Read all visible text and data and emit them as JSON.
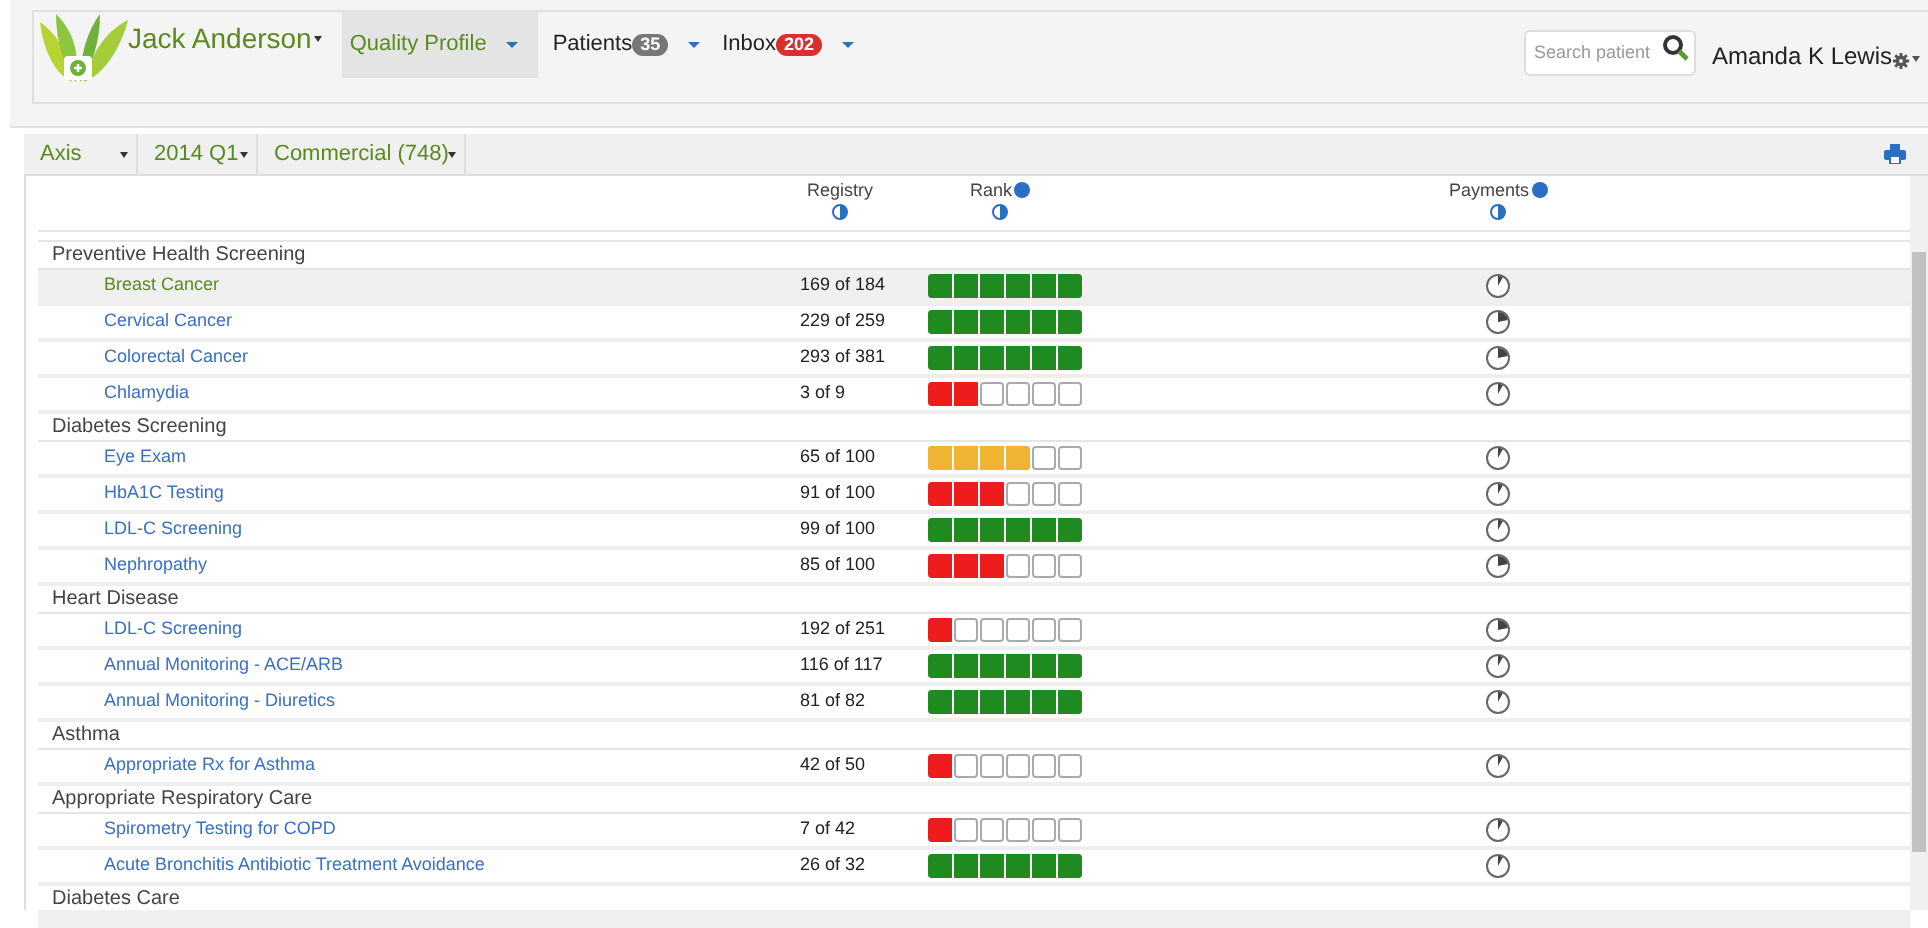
{
  "header": {
    "practice": "Jack Anderson",
    "nav": [
      {
        "label": "Quality Profile",
        "selected": true
      },
      {
        "label": "Patients",
        "badge": "35",
        "color": "#777777",
        "selected": false
      },
      {
        "label": "Inbox",
        "badge": "202",
        "color": "#d9302c",
        "selected": false
      }
    ],
    "search": {
      "placeholder": "Search patient"
    },
    "user": "Amanda K Lewis"
  },
  "filters": [
    "Axis",
    "2014 Q1",
    "Commercial (748)"
  ],
  "table": {
    "columns": [
      "Registry",
      "Rank",
      "Payments"
    ],
    "groups": [
      {
        "name": "Preventive Health Screening",
        "measures": [
          {
            "name": "Breast Cancer",
            "registry": "169 of 184",
            "level": 1,
            "color": "#1f8a1f",
            "payment": {
              "kind": "small"
            },
            "selected": true
          },
          {
            "name": "Cervical Cancer",
            "registry": "229 of 259",
            "level": 1,
            "color": "#1f8a1f",
            "payment": {
              "kind": "large"
            },
            "selected": false
          },
          {
            "name": "Colorectal Cancer",
            "registry": "293 of 381",
            "level": 1,
            "color": "#1f8a1f",
            "payment": {
              "kind": "large"
            },
            "selected": false
          },
          {
            "name": "Chlamydia",
            "registry": "3 of 9",
            "level": 0.333,
            "color": "#ee1c1c",
            "payment": {
              "kind": "small"
            },
            "selected": false
          }
        ]
      },
      {
        "name": "Diabetes Screening",
        "measures": [
          {
            "name": "Eye Exam",
            "registry": "65 of 100",
            "level": 0.667,
            "color": "#f0b332",
            "payment": {
              "kind": "small"
            },
            "selected": false
          },
          {
            "name": "HbA1C Testing",
            "registry": "91 of 100",
            "level": 0.5,
            "color": "#ee1c1c",
            "payment": {
              "kind": "small"
            },
            "selected": false
          },
          {
            "name": "LDL-C Screening",
            "registry": "99 of 100",
            "level": 1,
            "color": "#1f8a1f",
            "payment": {
              "kind": "small"
            },
            "selected": false
          },
          {
            "name": "Nephropathy",
            "registry": "85 of 100",
            "level": 0.5,
            "color": "#ee1c1c",
            "payment": {
              "kind": "large"
            },
            "selected": false
          }
        ]
      },
      {
        "name": "Heart Disease",
        "measures": [
          {
            "name": "LDL-C Screening",
            "registry": "192 of 251",
            "level": 0.167,
            "color": "#ee1c1c",
            "payment": {
              "kind": "large"
            },
            "selected": false
          },
          {
            "name": "Annual Monitoring - ACE/ARB",
            "registry": "116 of 117",
            "level": 1,
            "color": "#1f8a1f",
            "payment": {
              "kind": "small"
            },
            "selected": false
          },
          {
            "name": "Annual Monitoring - Diuretics",
            "registry": "81 of 82",
            "level": 1,
            "color": "#1f8a1f",
            "payment": {
              "kind": "small"
            },
            "selected": false
          }
        ]
      },
      {
        "name": "Asthma",
        "measures": [
          {
            "name": "Appropriate Rx for Asthma",
            "registry": "42 of 50",
            "level": 0.167,
            "color": "#ee1c1c",
            "payment": {
              "kind": "small"
            },
            "selected": false
          }
        ]
      },
      {
        "name": "Appropriate Respiratory Care",
        "measures": [
          {
            "name": "Spirometry Testing for COPD",
            "registry": "7 of 42",
            "level": 0.167,
            "color": "#ee1c1c",
            "payment": {
              "kind": "small"
            },
            "selected": false
          },
          {
            "name": "Acute Bronchitis Antibiotic Treatment Avoidance",
            "registry": "26 of 32",
            "level": 1,
            "color": "#1f8a1f",
            "payment": {
              "kind": "small"
            },
            "selected": false
          }
        ]
      },
      {
        "name": "Diabetes Care"
      }
    ]
  }
}
